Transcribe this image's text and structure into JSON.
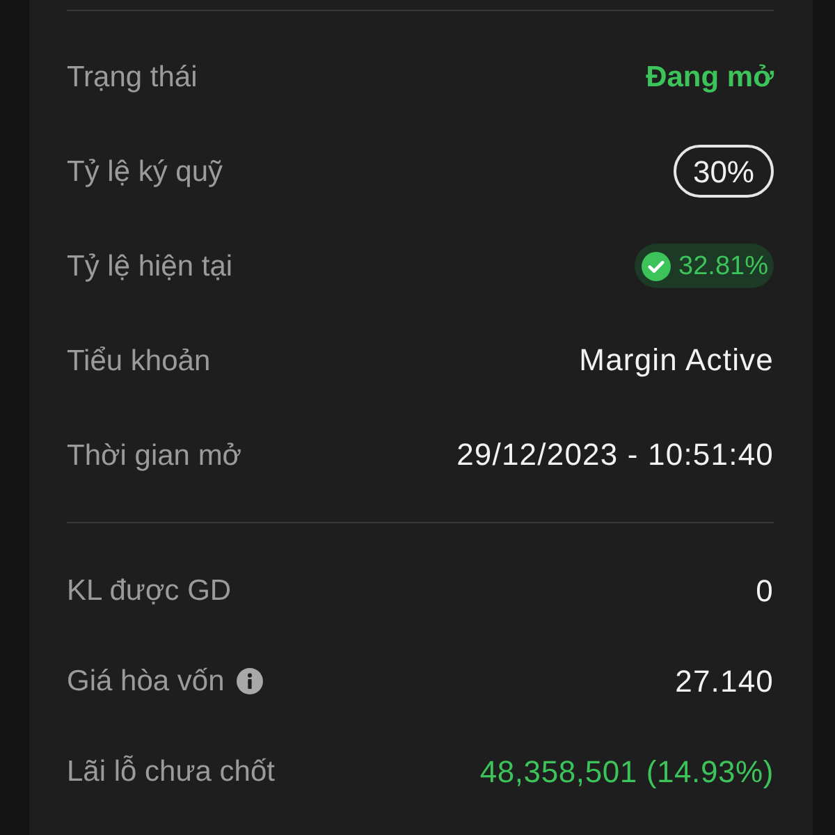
{
  "sections": [
    {
      "rows": [
        {
          "label": "Trạng thái",
          "value": {
            "kind": "status",
            "text": "Đang mở"
          }
        },
        {
          "label": "Tỷ lệ ký quỹ",
          "value": {
            "kind": "outline_badge",
            "text": "30%"
          }
        },
        {
          "label": "Tỷ lệ hiện tại",
          "value": {
            "kind": "check_badge",
            "text": "32.81%"
          }
        },
        {
          "label": "Tiểu khoản",
          "value": {
            "kind": "text",
            "text": "Margin Active"
          }
        },
        {
          "label": "Thời gian mở",
          "value": {
            "kind": "text",
            "text": "29/12/2023 - 10:51:40"
          }
        }
      ]
    },
    {
      "rows": [
        {
          "label": "KL được GD",
          "value": {
            "kind": "text",
            "text": "0"
          }
        },
        {
          "label": "Giá hòa vốn",
          "info": true,
          "value": {
            "kind": "text",
            "text": "27.140"
          }
        },
        {
          "label": "Lãi lỗ chưa chốt",
          "value": {
            "kind": "profit",
            "text": "48,358,501 (14.93%)"
          }
        }
      ]
    }
  ]
}
